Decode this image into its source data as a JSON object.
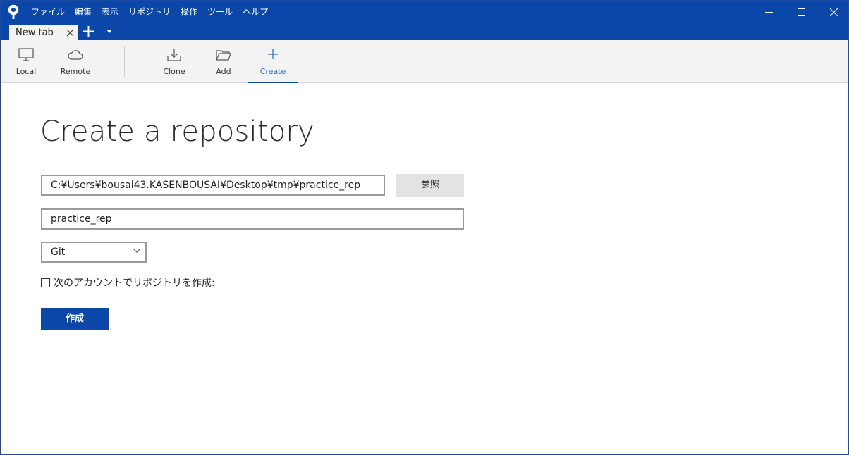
{
  "menu": {
    "items": [
      "ファイル",
      "編集",
      "表示",
      "リポジトリ",
      "操作",
      "ツール",
      "ヘルプ"
    ]
  },
  "window_controls": {
    "icons": [
      "minimize-icon",
      "maximize-icon",
      "close-icon"
    ]
  },
  "tabs": [
    {
      "label": "New tab",
      "active": true
    }
  ],
  "toolbar": {
    "local_label": "Local",
    "remote_label": "Remote",
    "clone_label": "Clone",
    "add_label": "Add",
    "create_label": "Create",
    "active": "Create"
  },
  "main": {
    "title": "Create a repository",
    "path_value": "C:¥Users¥bousai43.KASENBOUSAI¥Desktop¥tmp¥practice_rep",
    "browse_label": "参照",
    "name_value": "practice_rep",
    "vcs_selected": "Git",
    "account_checkbox_label": "次のアカウントでリポジトリを作成:",
    "account_checkbox_checked": false,
    "create_button_label": "作成"
  },
  "colors": {
    "accent": "#0a47a9",
    "active_tool_text": "#2a72d0",
    "toolbar_bg": "#f3f3f3"
  }
}
